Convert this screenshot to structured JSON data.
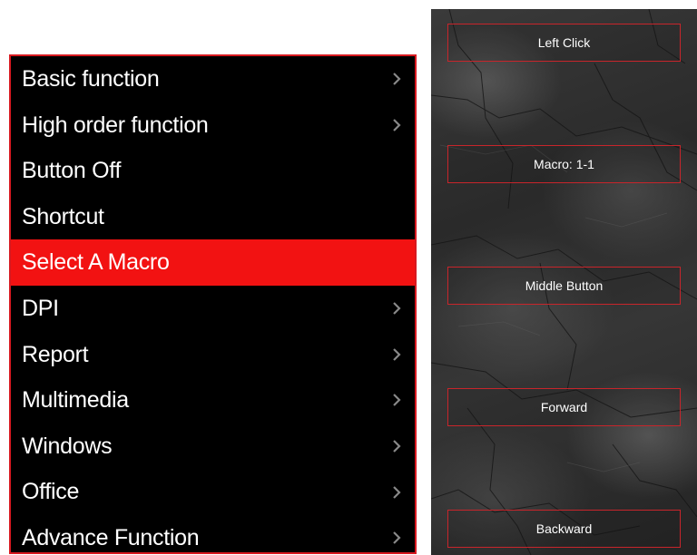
{
  "menu": {
    "items": [
      {
        "label": "Basic function",
        "has_submenu": true,
        "selected": false
      },
      {
        "label": "High order function",
        "has_submenu": true,
        "selected": false
      },
      {
        "label": "Button Off",
        "has_submenu": false,
        "selected": false
      },
      {
        "label": "Shortcut",
        "has_submenu": false,
        "selected": false
      },
      {
        "label": "Select A Macro",
        "has_submenu": false,
        "selected": true
      },
      {
        "label": "DPI",
        "has_submenu": true,
        "selected": false
      },
      {
        "label": "Report",
        "has_submenu": true,
        "selected": false
      },
      {
        "label": "Multimedia",
        "has_submenu": true,
        "selected": false
      },
      {
        "label": "Windows",
        "has_submenu": true,
        "selected": false
      },
      {
        "label": "Office",
        "has_submenu": true,
        "selected": false
      },
      {
        "label": "Advance Function",
        "has_submenu": true,
        "selected": false
      }
    ],
    "submenu_icon": "chevron-right-icon"
  },
  "buttons": {
    "left_click": "Left Click",
    "macro": "Macro: 1-1",
    "middle_button": "Middle Button",
    "forward": "Forward",
    "backward": "Backward"
  },
  "colors": {
    "accent_red": "#f21212",
    "border_red": "#d71920",
    "menu_background": "#000000",
    "text": "#ffffff"
  }
}
